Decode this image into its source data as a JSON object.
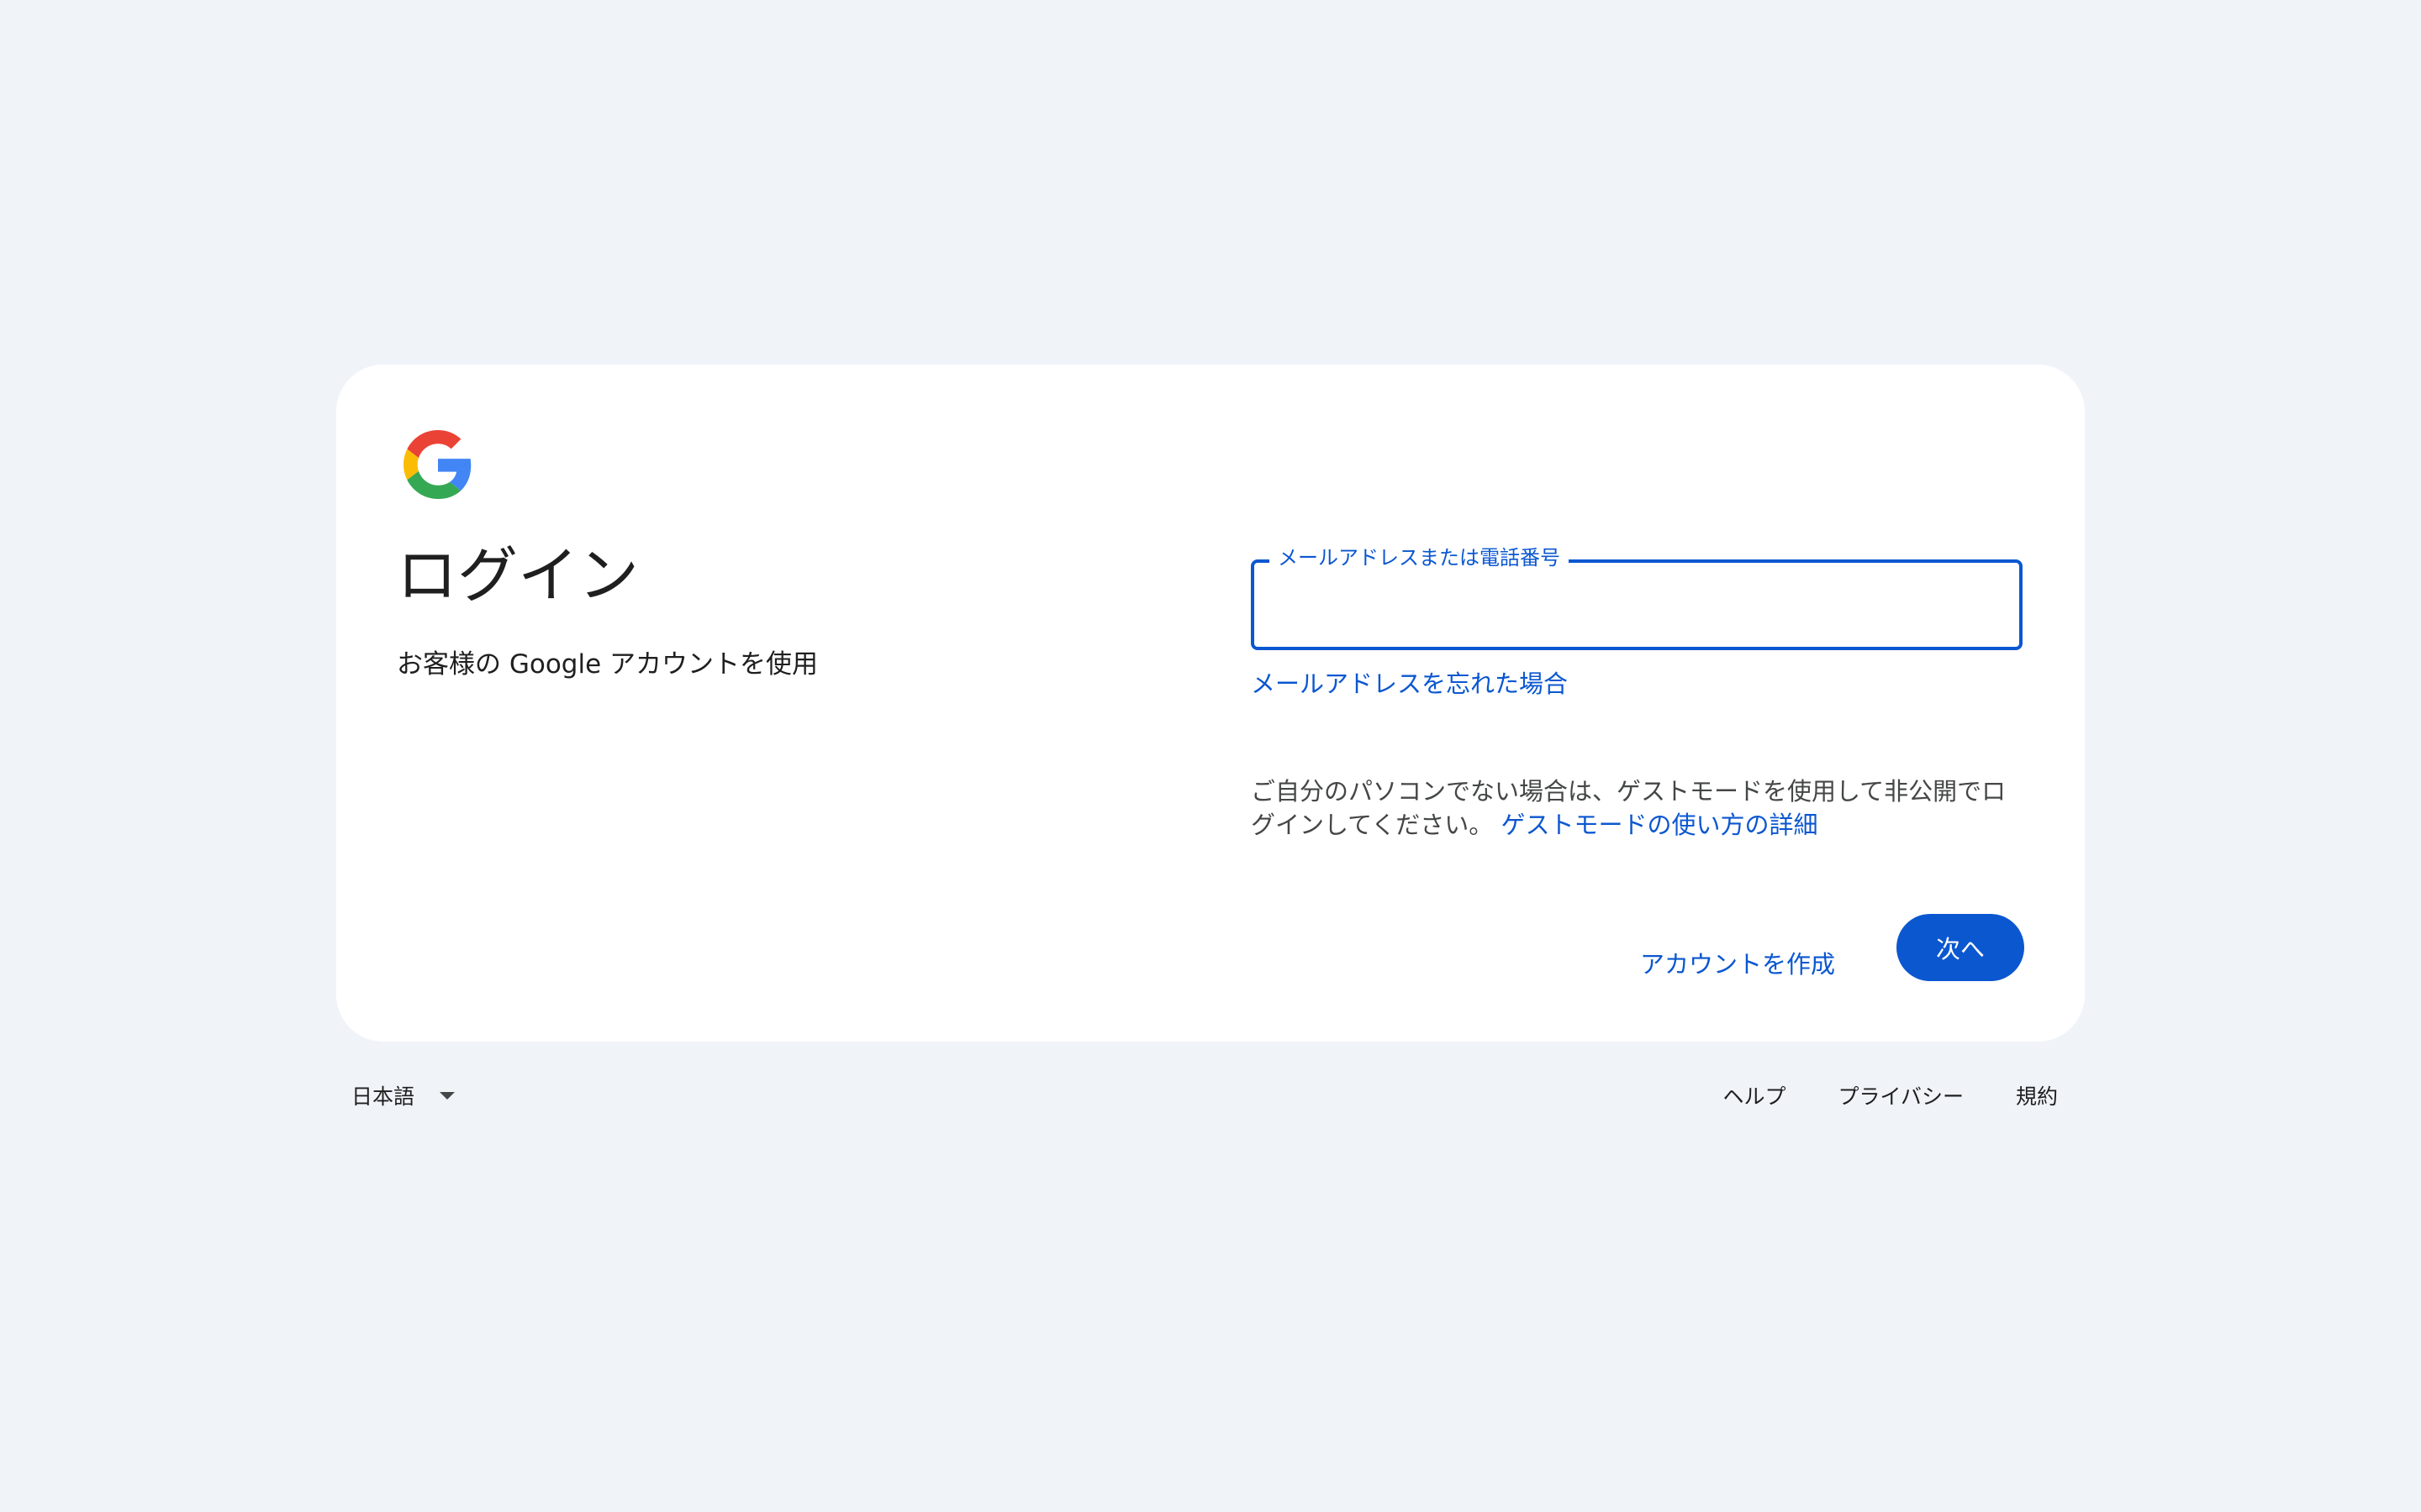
{
  "logo": {
    "icon": "google-g-icon",
    "colors": {
      "blue": "#4285F4",
      "red": "#EA4335",
      "yellow": "#FBBC05",
      "green": "#34A853"
    }
  },
  "header": {
    "title": "ログイン",
    "subtitle": "お客様の Google アカウントを使用"
  },
  "form": {
    "email_label": "メールアドレスまたは電話番号",
    "email_value": "",
    "forgot_email_link": "メールアドレスを忘れた場合",
    "guest_text": "ご自分のパソコンでない場合は、ゲストモードを使用して非公開でログインしてください。",
    "guest_link": "ゲストモードの使い方の詳細"
  },
  "actions": {
    "create_account": "アカウントを作成",
    "next": "次へ"
  },
  "footer": {
    "language": "日本語",
    "language_icon": "caret-down-icon",
    "links": {
      "help": "ヘルプ",
      "privacy": "プライバシー",
      "terms": "規約"
    }
  },
  "colors": {
    "background": "#f0f4f9",
    "card": "#ffffff",
    "accent": "#0b57d0",
    "text": "#1f1f1f",
    "secondary_text": "#444746"
  }
}
